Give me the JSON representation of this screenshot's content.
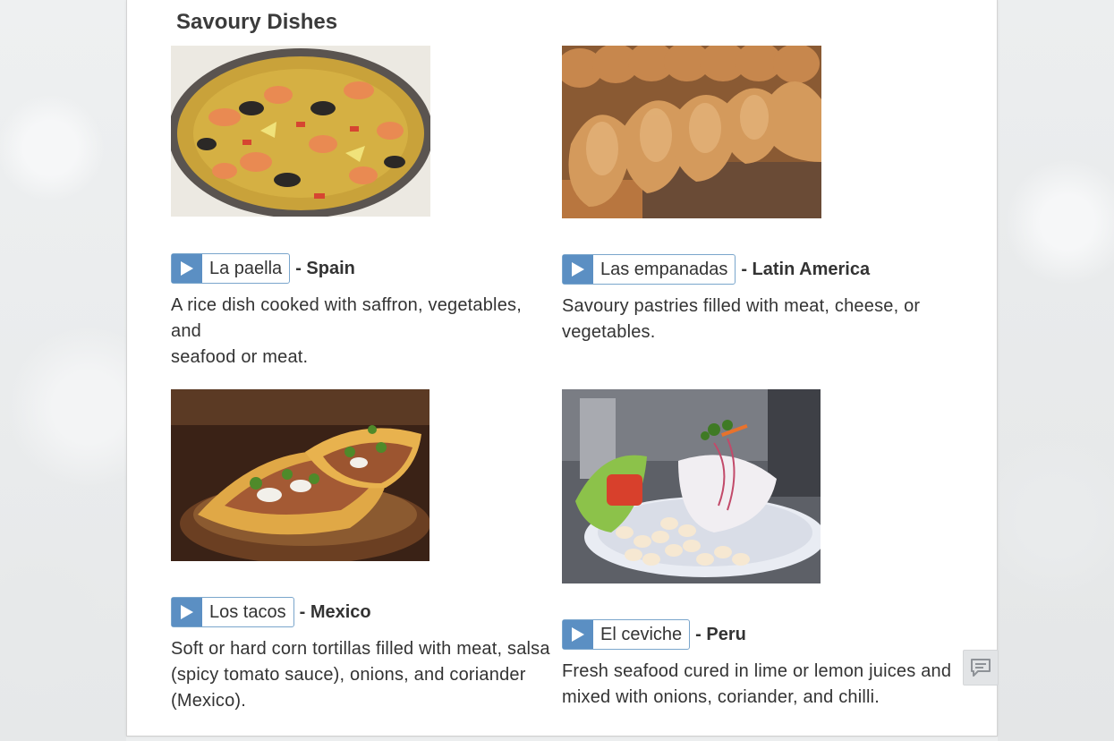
{
  "section": {
    "title": "Savoury Dishes"
  },
  "dishes": [
    {
      "word": "La paella",
      "country": "- Spain",
      "desc_line1": "A rice dish cooked with saffron, vegetables, and",
      "desc_line2": "seafood or meat.",
      "desc_line3": ""
    },
    {
      "word": "Las empanadas",
      "country": "- Latin America",
      "desc_line1": "Savoury pastries filled with meat, cheese, or",
      "desc_line2": "vegetables.",
      "desc_line3": ""
    },
    {
      "word": "Los tacos",
      "country": "- Mexico",
      "desc_line1": "Soft or hard corn tortillas filled with meat, salsa",
      "desc_line2": "(spicy tomato sauce), onions, and coriander",
      "desc_line3": "(Mexico)."
    },
    {
      "word": "El ceviche",
      "country": "- Peru",
      "desc_line1": "Fresh seafood cured in lime or lemon juices and",
      "desc_line2": "mixed with onions, coriander, and chilli.",
      "desc_line3": ""
    }
  ],
  "icons": {
    "play": "play-icon",
    "feedback": "comment-icon"
  },
  "colors": {
    "accent": "#5b8fc3",
    "text": "#333333"
  }
}
